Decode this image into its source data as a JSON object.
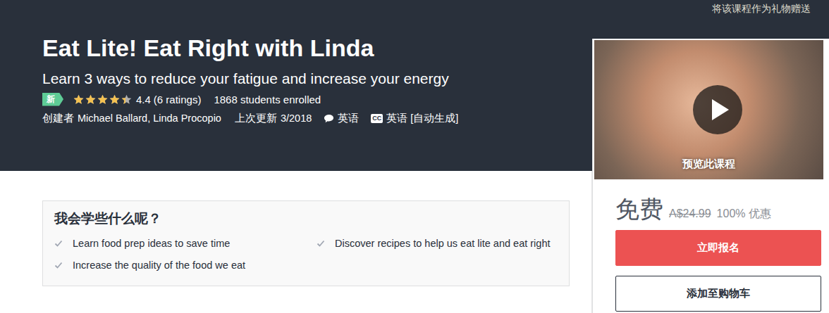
{
  "top_bar": {
    "gift_link": "将该课程作为礼物赠送"
  },
  "course": {
    "title": "Eat Lite! Eat Right with Linda",
    "subtitle": "Learn 3 ways to reduce your fatigue and increase your energy",
    "badge": "新",
    "stars": 4.4,
    "rating": "4.4",
    "ratings_count": "(6 ratings)",
    "enrolled": "1868 students enrolled",
    "created_by_label": "创建者",
    "authors": "Michael Ballard, Linda Procopio",
    "updated_label": "上次更新",
    "updated": "3/2018",
    "language": "英语",
    "captions_icon": "CC",
    "captions": "英语 [自动生成]"
  },
  "preview": {
    "label": "预览此课程"
  },
  "pricing": {
    "price": "免费",
    "original_price": "A$24.99",
    "discount": "100% 优惠"
  },
  "buttons": [
    "立即报名",
    "添加至购物车"
  ],
  "learn": {
    "heading": "我会学些什么呢？",
    "items": [
      "Learn food prep ideas to save time",
      "Discover recipes to help us eat lite and eat right",
      "Increase the quality of the food we eat"
    ]
  }
}
